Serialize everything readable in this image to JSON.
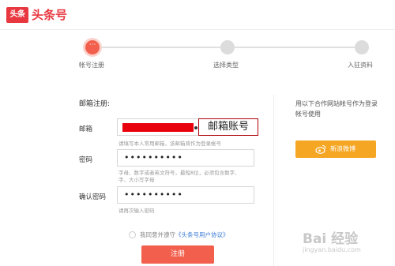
{
  "header": {
    "logo_mark": "头条",
    "logo_text": "头条号"
  },
  "steps": [
    {
      "label": "帐号注册",
      "active": true
    },
    {
      "label": "选择类型",
      "active": false
    },
    {
      "label": "入驻资料",
      "active": false
    }
  ],
  "active_step_icon": "···",
  "form": {
    "section_title": "邮箱注册:",
    "email": {
      "label": "邮箱",
      "hint": "请填写本人常用邮箱，该邮箱将作为登录帐号"
    },
    "password": {
      "label": "密码",
      "value": "••••••••••",
      "hint_line1": "字母、数字或者英文符号，最短8位，必须包含数字、",
      "hint_line2": "字、大小写字母"
    },
    "confirm_password": {
      "label": "确认密码",
      "value": "••••••••••",
      "hint": "请再次输入密码"
    },
    "annotation": "邮箱账号",
    "agree_prefix": "我同意并遵守",
    "agree_link": "《头条号用户协议》",
    "register_label": "注册"
  },
  "partner": {
    "text": "用以下合作网站帐号作为登录帐号使用",
    "weibo_label": "新浪微博",
    "weibo_icon": "weibo-icon"
  },
  "watermark": {
    "logo": "Bai 经验",
    "url": "jingyan.baidu.com"
  },
  "colors": {
    "brand": "#e8373f",
    "accent": "#f25f4c",
    "weibo": "#f5a623",
    "link": "#3a7bd5",
    "redaction": "#e8000c"
  }
}
